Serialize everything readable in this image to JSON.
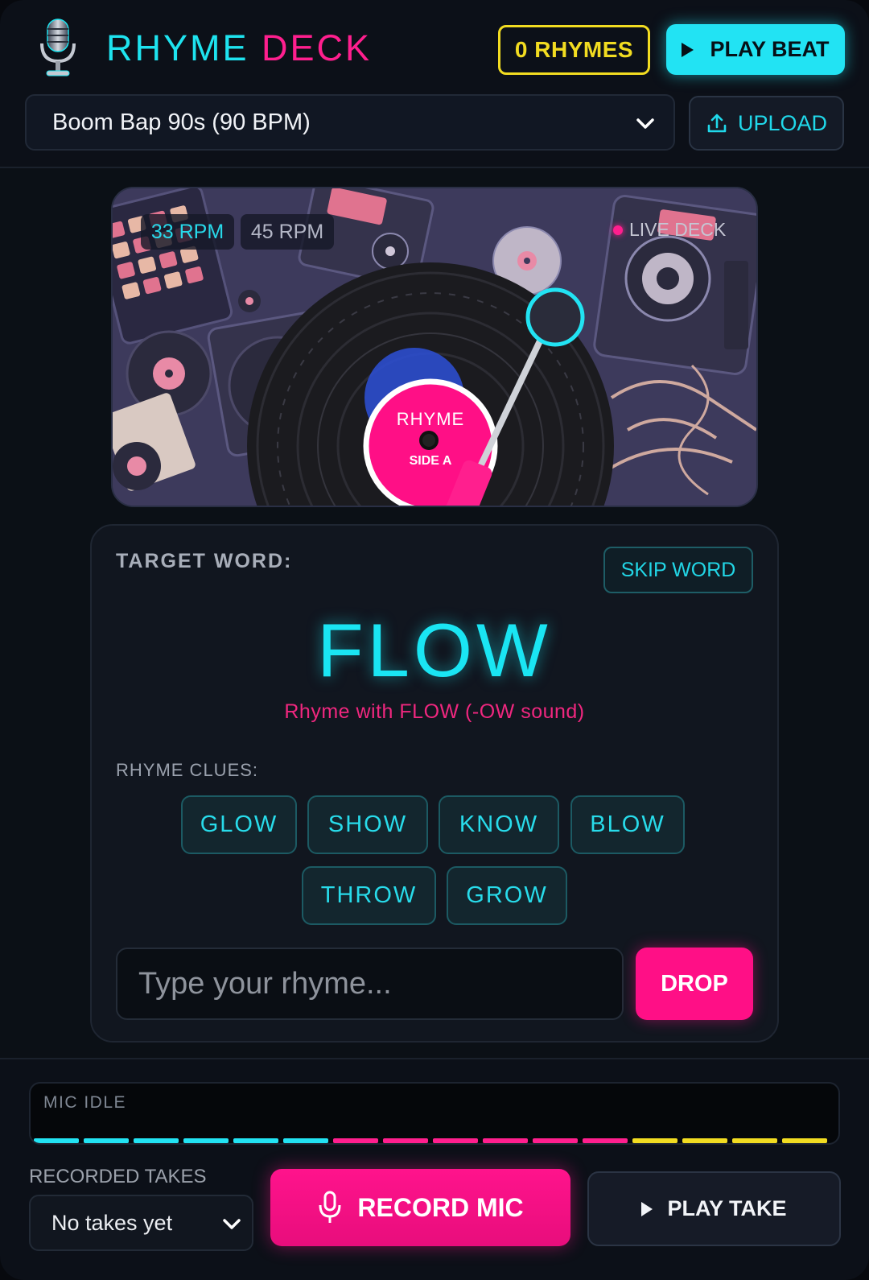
{
  "header": {
    "title_part1": "RHYME",
    "title_part2": "DECK",
    "rhymes_count_label": "0 RHYMES",
    "play_beat_label": "PLAY BEAT",
    "logo_icon": "microphone-icon"
  },
  "beat": {
    "selected": "Boom Bap 90s (90 BPM)",
    "upload_label": "UPLOAD"
  },
  "deck": {
    "rpm_33_label": "33 RPM",
    "rpm_45_label": "45 RPM",
    "live_deck_label": "LIVE DECK",
    "record_label_top": "RHYME",
    "record_label_bottom": "SIDE A"
  },
  "challenge": {
    "target_label": "TARGET WORD:",
    "skip_label": "SKIP WORD",
    "word": "FLOW",
    "hint": "Rhyme with FLOW (-OW sound)",
    "clues_label": "RHYME CLUES:",
    "clues": [
      "GLOW",
      "SHOW",
      "KNOW",
      "BLOW",
      "THROW",
      "GROW"
    ],
    "input_placeholder": "Type your rhyme...",
    "input_value": "",
    "drop_label": "DROP"
  },
  "mic": {
    "status_label": "MIC IDLE",
    "level": 0
  },
  "takes": {
    "label": "RECORDED TAKES",
    "selected": "No takes yet",
    "record_label": "RECORD MIC",
    "play_label": "PLAY TAKE"
  },
  "colors": {
    "background": "#0c1018",
    "accent_cyan": "#22e3f3",
    "accent_pink": "#ff0f86",
    "accent_yellow": "#f2dc21"
  }
}
